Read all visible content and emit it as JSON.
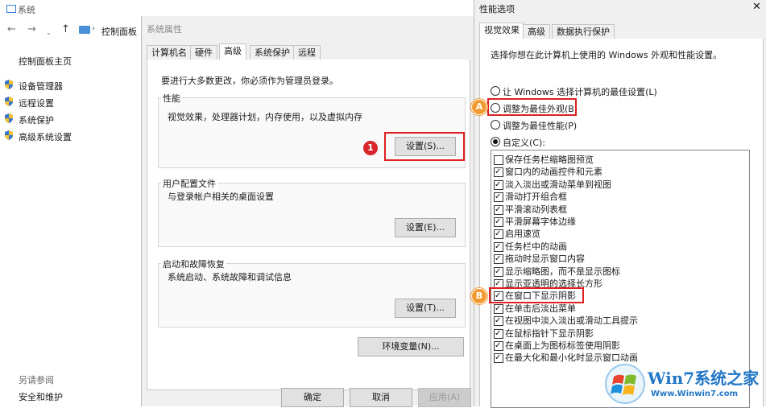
{
  "system_window": {
    "title": "系统",
    "nav": {
      "back": "←",
      "forward": "→",
      "up": "↑"
    },
    "breadcrumb": "控制面板",
    "sidebar": {
      "home": "控制面板主页",
      "items": [
        {
          "label": "设备管理器"
        },
        {
          "label": "远程设置"
        },
        {
          "label": "系统保护"
        },
        {
          "label": "高级系统设置"
        }
      ],
      "see_also": "另请参阅",
      "security": "安全和维护"
    }
  },
  "system_properties": {
    "title": "系统属性",
    "tabs": [
      {
        "label": "计算机名"
      },
      {
        "label": "硬件"
      },
      {
        "label": "高级"
      },
      {
        "label": "系统保护"
      },
      {
        "label": "远程"
      }
    ],
    "notice": "要进行大多数更改，你必须作为管理员登录。",
    "performance": {
      "label": "性能",
      "desc": "视觉效果，处理器计划，内存使用，以及虚拟内存",
      "button": "设置(S)..."
    },
    "profiles": {
      "label": "用户配置文件",
      "desc": "与登录帐户相关的桌面设置",
      "button": "设置(E)..."
    },
    "startup": {
      "label": "启动和故障恢复",
      "desc": "系统启动、系统故障和调试信息",
      "button": "设置(T)..."
    },
    "env_button": "环境变量(N)...",
    "ok": "确定",
    "cancel": "取消",
    "apply": "应用(A)",
    "marker": "1"
  },
  "performance_options": {
    "title": "性能选项",
    "close": "✕",
    "tabs": [
      {
        "label": "视觉效果"
      },
      {
        "label": "高级"
      },
      {
        "label": "数据执行保护"
      }
    ],
    "intro": "选择你想在此计算机上使用的 Windows 外观和性能设置。",
    "radios": [
      {
        "label": "让 Windows 选择计算机的最佳设置(L)"
      },
      {
        "label": "调整为最佳外观(B)"
      },
      {
        "label": "调整为最佳性能(P)"
      },
      {
        "label": "自定义(C):"
      }
    ],
    "selected_radio": 3,
    "checkboxes": [
      {
        "label": "保存任务栏缩略图预览",
        "checked": false
      },
      {
        "label": "窗口内的动画控件和元素",
        "checked": true
      },
      {
        "label": "淡入淡出或滑动菜单到视图",
        "checked": true
      },
      {
        "label": "滑动打开组合框",
        "checked": true
      },
      {
        "label": "平滑滚动列表框",
        "checked": true
      },
      {
        "label": "平滑屏幕字体边缘",
        "checked": true
      },
      {
        "label": "启用速览",
        "checked": true
      },
      {
        "label": "任务栏中的动画",
        "checked": true
      },
      {
        "label": "拖动时显示窗口内容",
        "checked": true
      },
      {
        "label": "显示缩略图，而不是显示图标",
        "checked": true
      },
      {
        "label": "显示亚透明的选择长方形",
        "checked": true
      },
      {
        "label": "在窗口下显示阴影",
        "checked": true
      },
      {
        "label": "在单击后淡出菜单",
        "checked": true
      },
      {
        "label": "在视图中淡入淡出或滑动工具提示",
        "checked": true
      },
      {
        "label": "在鼠标指针下显示阴影",
        "checked": true
      },
      {
        "label": "在桌面上为图标标签使用阴影",
        "checked": true
      },
      {
        "label": "在最大化和最小化时显示窗口动画",
        "checked": true
      }
    ],
    "marker_a": "A",
    "marker_b": "B"
  },
  "watermark": {
    "brand": "Win7系统之家",
    "url": "Www.Winwin7.com"
  },
  "colors": {
    "highlight_red": "#e02020",
    "marker_red": "#d9262c",
    "marker_orange": "#f39a32"
  }
}
